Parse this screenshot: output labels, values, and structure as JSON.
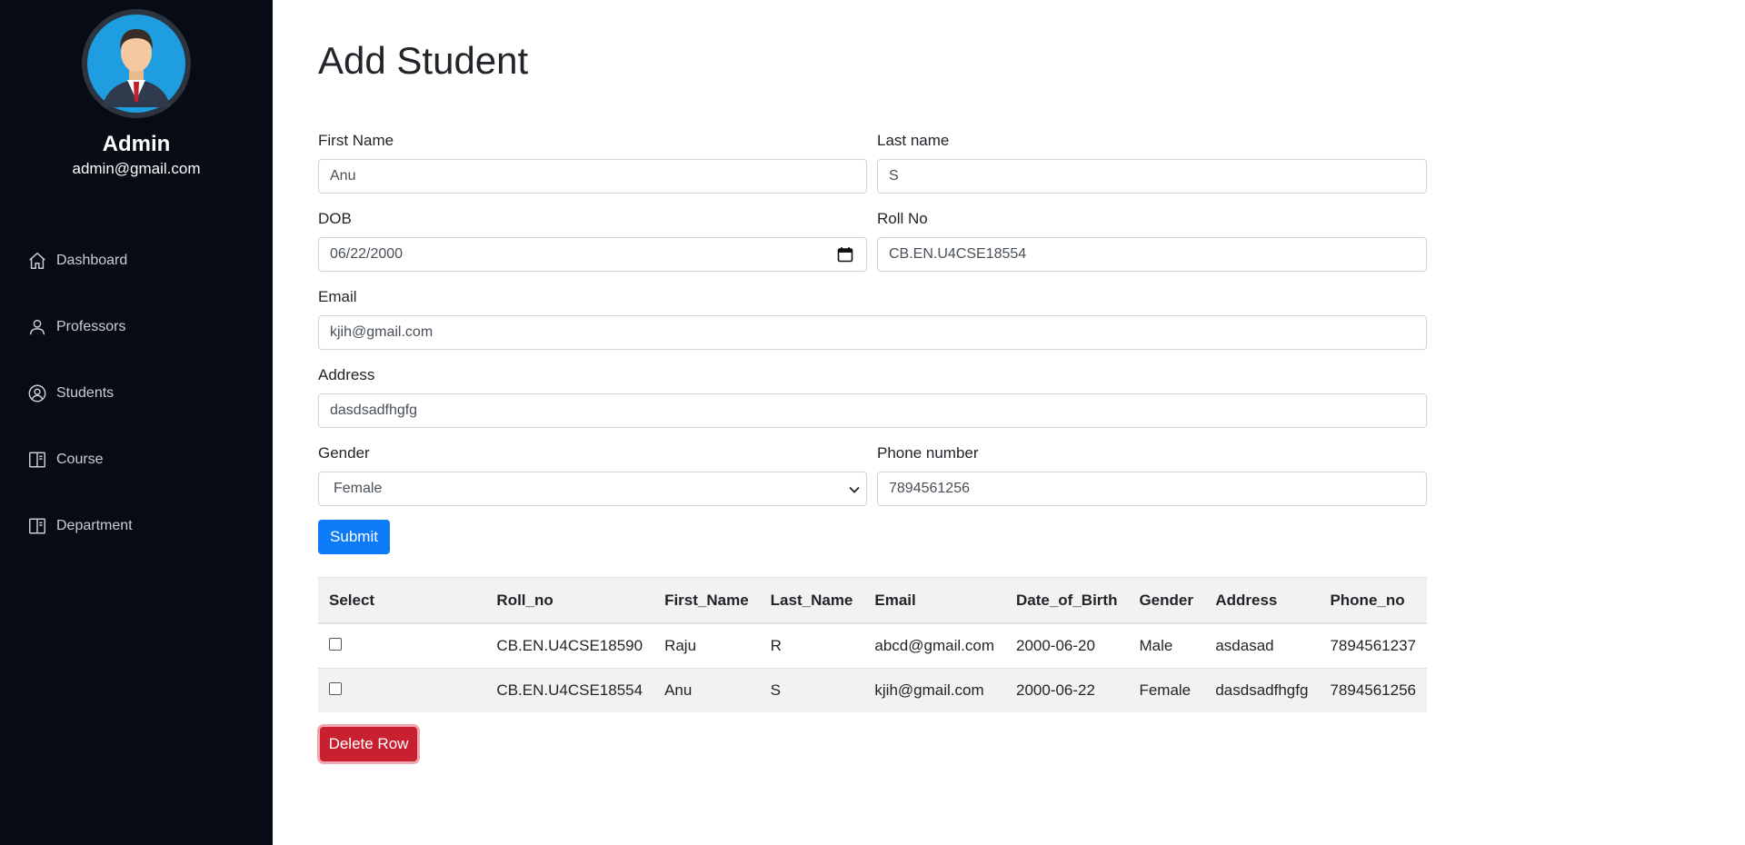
{
  "sidebar": {
    "admin_name": "Admin",
    "admin_email": "admin@gmail.com",
    "items": [
      {
        "label": "Dashboard",
        "icon": "home-icon"
      },
      {
        "label": "Professors",
        "icon": "person-icon"
      },
      {
        "label": "Students",
        "icon": "user-circle-icon"
      },
      {
        "label": "Course",
        "icon": "book-icon"
      },
      {
        "label": "Department",
        "icon": "book-icon"
      }
    ]
  },
  "page": {
    "title": "Add Student"
  },
  "form": {
    "first_name": {
      "label": "First Name",
      "value": "Anu"
    },
    "last_name": {
      "label": "Last name",
      "value": "S"
    },
    "dob": {
      "label": "DOB",
      "value": "06/22/2000"
    },
    "roll_no": {
      "label": "Roll No",
      "value": "CB.EN.U4CSE18554"
    },
    "email": {
      "label": "Email",
      "value": "kjih@gmail.com"
    },
    "address": {
      "label": "Address",
      "value": "dasdsadfhgfg"
    },
    "gender": {
      "label": "Gender",
      "value": "Female"
    },
    "phone": {
      "label": "Phone number",
      "value": "7894561256"
    },
    "submit_label": "Submit"
  },
  "table": {
    "headers": [
      "Select",
      "Roll_no",
      "First_Name",
      "Last_Name",
      "Email",
      "Date_of_Birth",
      "Gender",
      "Address",
      "Phone_no"
    ],
    "rows": [
      {
        "roll_no": "CB.EN.U4CSE18590",
        "first_name": "Raju",
        "last_name": "R",
        "email": "abcd@gmail.com",
        "dob": "2000-06-20",
        "gender": "Male",
        "address": "asdasad",
        "phone": "7894561237"
      },
      {
        "roll_no": "CB.EN.U4CSE18554",
        "first_name": "Anu",
        "last_name": "S",
        "email": "kjih@gmail.com",
        "dob": "2000-06-22",
        "gender": "Female",
        "address": "dasdsadfhgfg",
        "phone": "7894561256"
      }
    ]
  },
  "delete_label": "Delete Row",
  "colors": {
    "sidebar_bg": "#060b14",
    "primary": "#0d7bf7",
    "danger": "#c8202f"
  }
}
